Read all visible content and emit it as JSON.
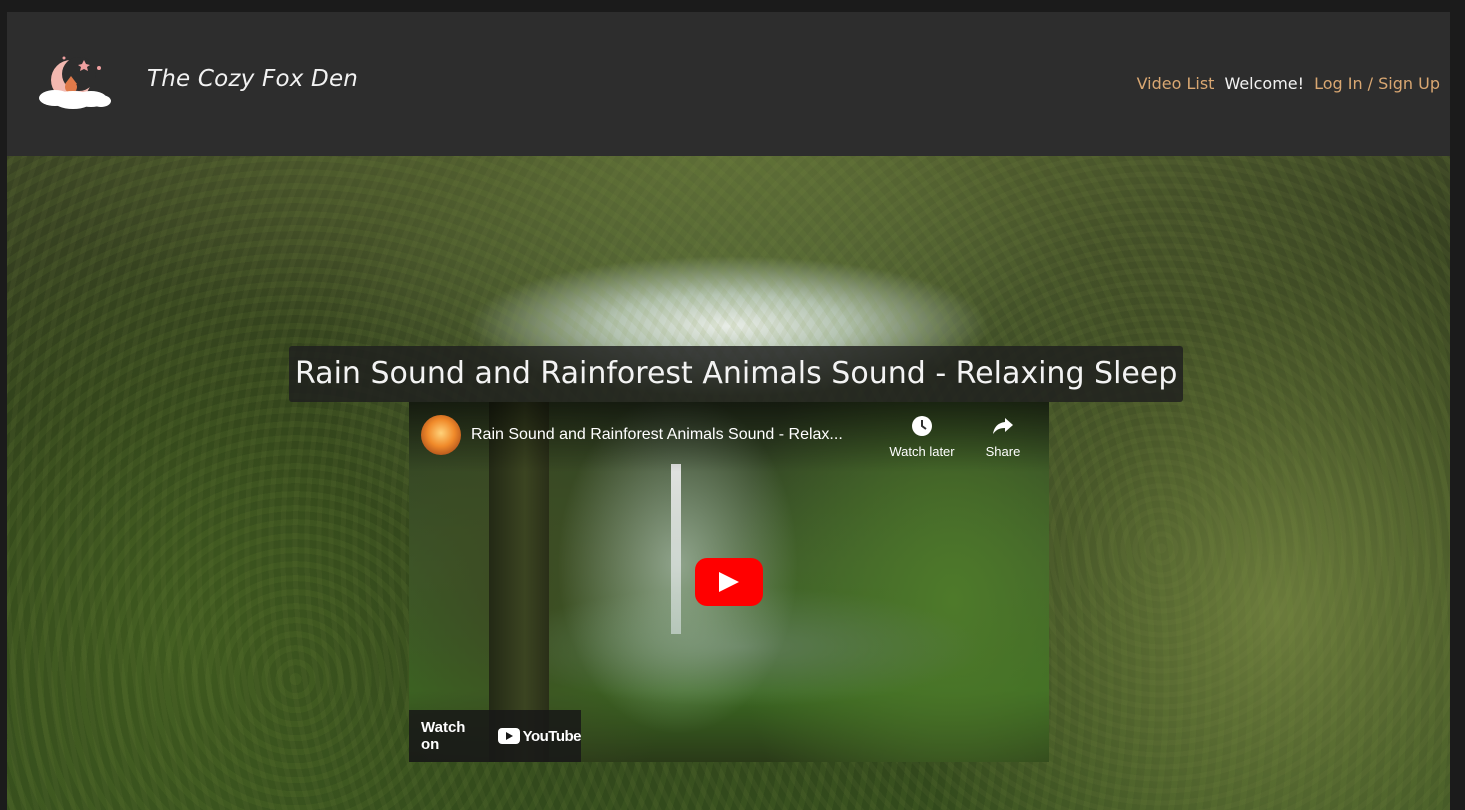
{
  "header": {
    "brand": "The Cozy Fox Den",
    "nav": {
      "video_list": "Video List",
      "welcome": "Welcome!",
      "login": "Log In / Sign Up"
    }
  },
  "video": {
    "page_title": "Rain Sound and Rainforest Animals Sound - Relaxing Sleep",
    "player": {
      "title": "Rain Sound and Rainforest Animals Sound - Relax...",
      "watch_later": "Watch later",
      "share": "Share",
      "watch_on": "Watch on",
      "youtube": "YouTube"
    }
  },
  "colors": {
    "nav_link": "#d9a772",
    "header_bg": "#2d2d2d",
    "play_red": "#ff0000"
  },
  "icons": [
    "fox-moon-logo",
    "clock-icon",
    "share-icon",
    "play-icon",
    "youtube-logo-icon"
  ]
}
